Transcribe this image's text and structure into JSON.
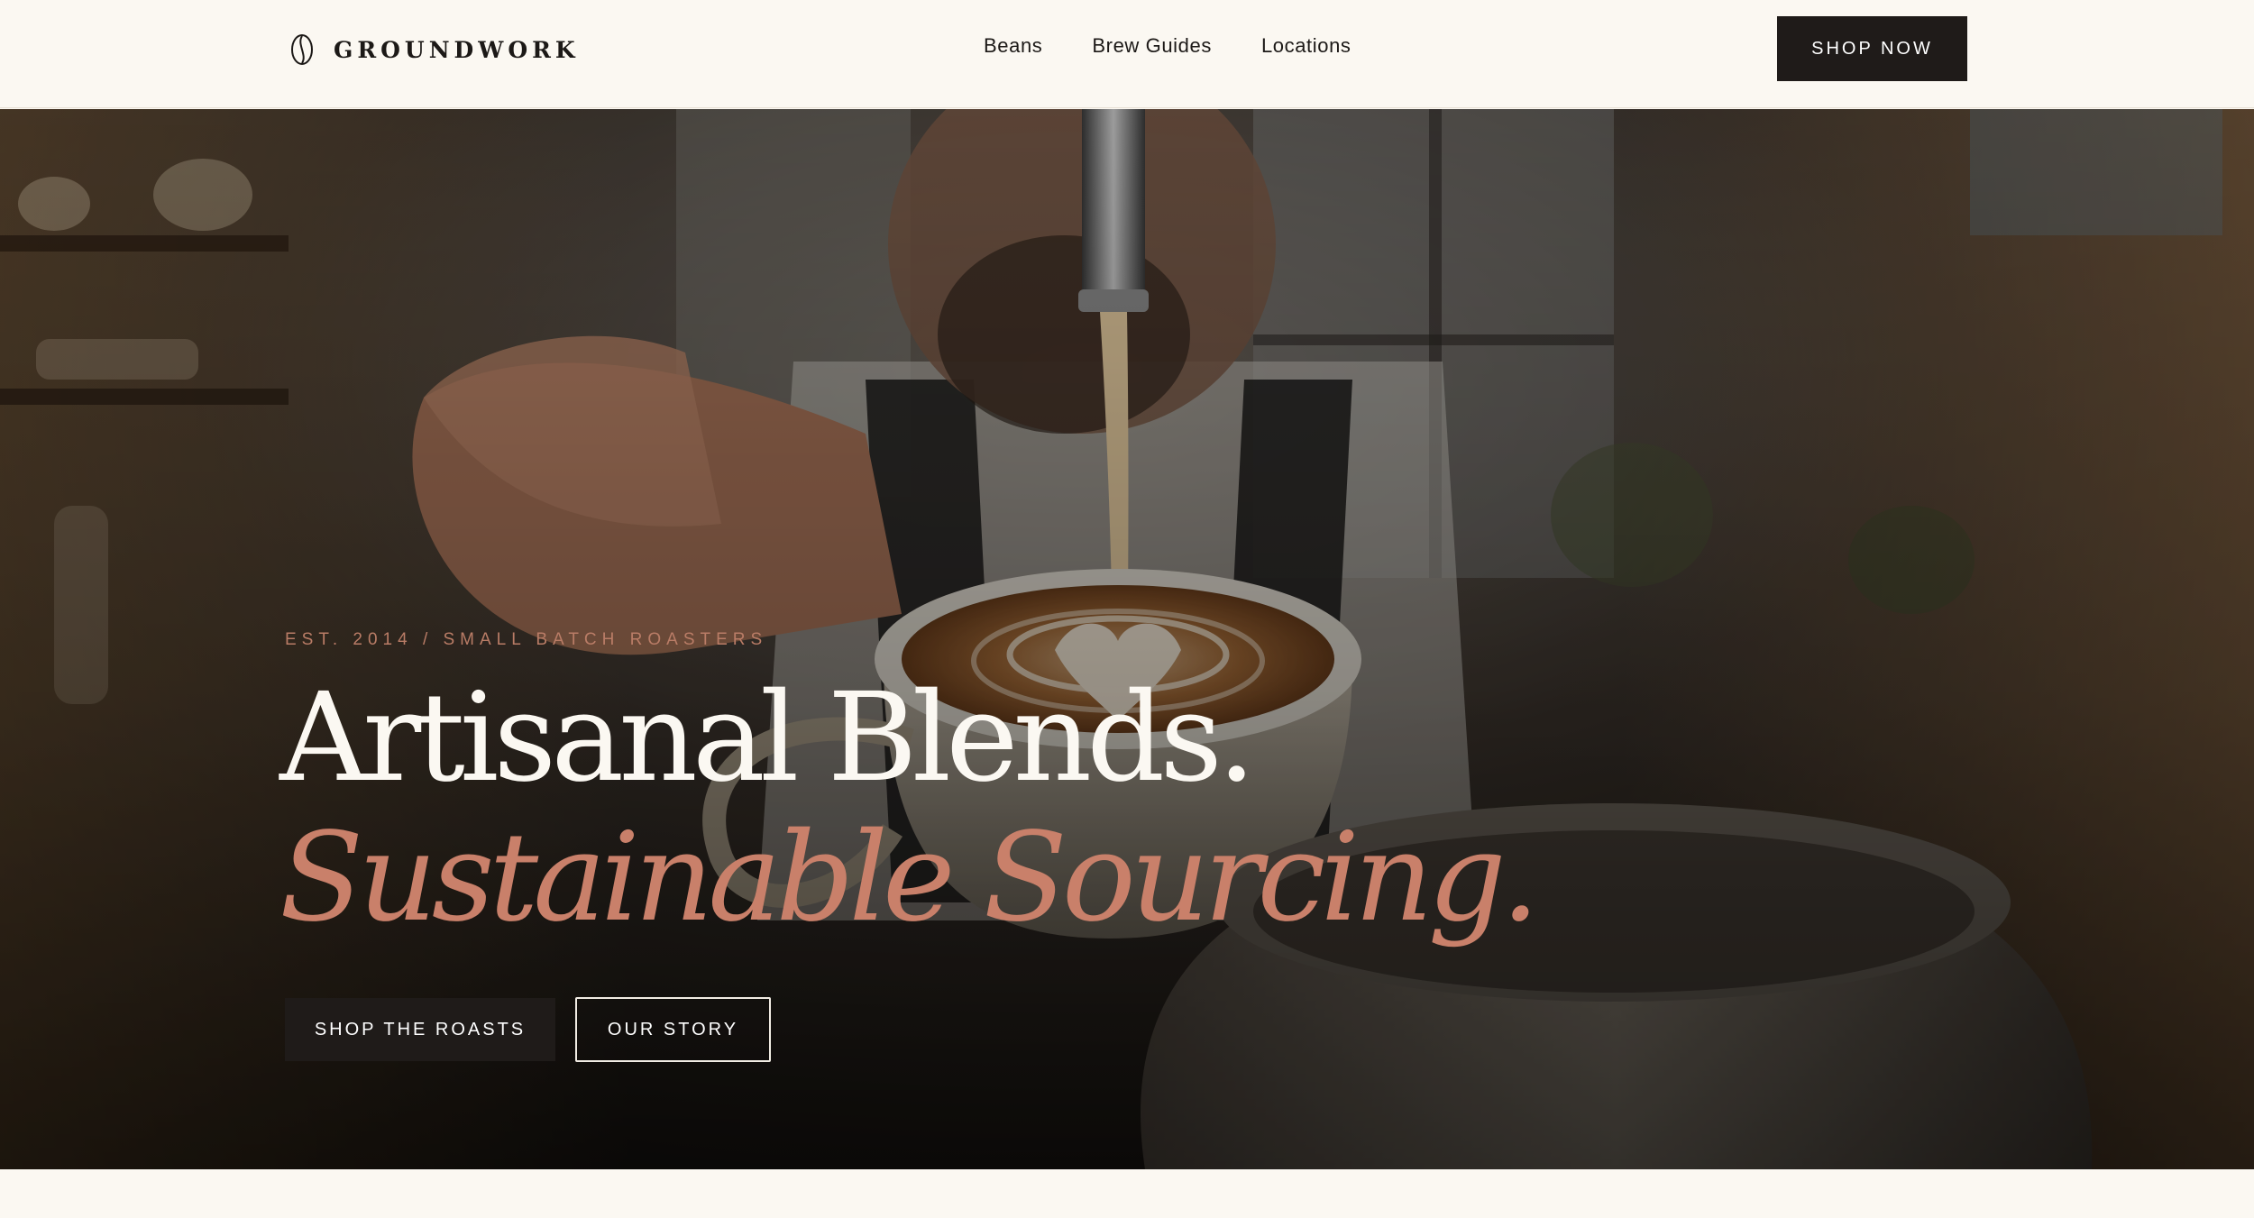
{
  "brand": {
    "name": "GROUNDWORK",
    "logo_icon": "coffee-bean-icon"
  },
  "nav": {
    "links": [
      "Beans",
      "Brew Guides",
      "Locations"
    ],
    "cta_label": "SHOP NOW"
  },
  "hero": {
    "eyebrow": "EST. 2014 / SMALL BATCH ROASTERS",
    "headline_line1": "Artisanal Blends.",
    "headline_line2": "Sustainable Sourcing.",
    "primary_cta": "SHOP THE ROASTS",
    "secondary_cta": "OUR STORY",
    "image": "barista-pouring-latte-art-photo"
  },
  "colors": {
    "background": "#fbf8f2",
    "ink": "#1c1917",
    "accent": "#c9806a",
    "button_dark": "#1f1b19"
  }
}
